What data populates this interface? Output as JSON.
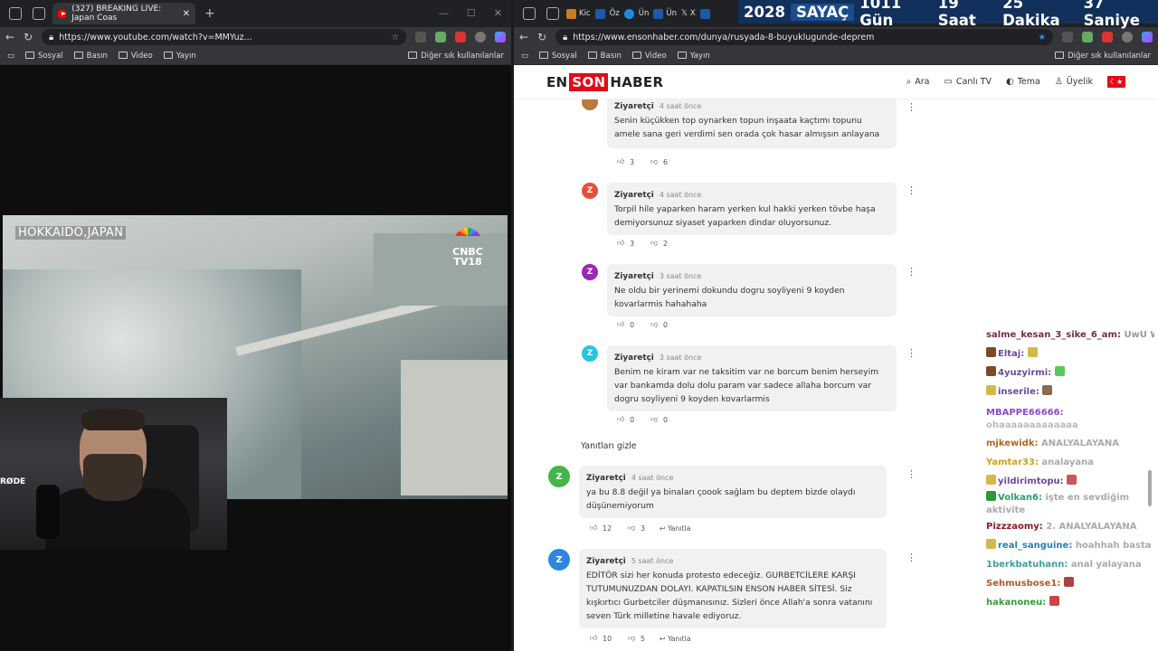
{
  "left": {
    "tab_title": "(327) BREAKING LIVE: Japan Coas",
    "url": "https://www.youtube.com/watch?v=MMYuz...",
    "bookmarks": [
      "Sosyal",
      "Basın",
      "Video",
      "Yayın"
    ],
    "bookmarks_right": "Diğer sık kullanılanlar",
    "video_location": "HOKKAIDO,JAPAN",
    "channel_logo_line1": "CNBC",
    "channel_logo_line2": "TV18",
    "cam_mic_brand": "RØDE"
  },
  "right": {
    "mini_tabs": [
      "Kic",
      "Öz",
      "Ün",
      "Ün",
      "X"
    ],
    "counter": {
      "label_year": "2028",
      "label_title": "SAYAÇ",
      "days": "1011 Gün",
      "hours": "19 Saat",
      "minutes": "25 Dakika",
      "seconds": "37 Saniye"
    },
    "url": "https://www.ensonhaber.com/dunya/rusyada-8-buyuklugunde-deprem",
    "bookmarks": [
      "Sosyal",
      "Basın",
      "Video",
      "Yayın"
    ],
    "bookmarks_right": "Diğer sık kullanılanlar",
    "logo": {
      "a": "EN",
      "b": "SON",
      "c": "HABER"
    },
    "nav": [
      "Ara",
      "Canlı TV",
      "Tema",
      "Üyelik"
    ],
    "flag_glyph": "☾★",
    "comments": [
      {
        "name": "Ziyaretçi",
        "time": "4 saat önce",
        "text": "Senin küçükken top oynarken topun inşaata kaçtımı topunu amele sana geri verdimi sen orada çok hasar almışsın anlayana",
        "likes": "3",
        "dislikes": "6",
        "avatar": "",
        "color": "#b97a3c"
      },
      {
        "name": "Ziyaretçi",
        "time": "4 saat önce",
        "text": "Torpil hile yaparken haram yerken kul hakki yerken tövbe haşa demiyorsunuz siyaset yaparken dindar oluyorsunuz.",
        "likes": "3",
        "dislikes": "2",
        "avatar": "Z",
        "color": "#e0533a"
      },
      {
        "name": "Ziyaretçi",
        "time": "3 saat önce",
        "text": "Ne oldu bir yerinemi dokundu dogru soyliyeni 9 koyden kovarlarmis hahahaha",
        "likes": "0",
        "dislikes": "0",
        "avatar": "Z",
        "color": "#9c27b0"
      },
      {
        "name": "Ziyaretçi",
        "time": "3 saat önce",
        "text": "Benim ne kiram var ne taksitim var ne borcum benim herseyim var bankamda dolu dolu param var sadece allaha borcum var dogru soyliyeni 9 koyden kovarlarmis",
        "likes": "0",
        "dislikes": "0",
        "avatar": "Z",
        "color": "#26c6da"
      },
      {
        "name": "Ziyaretçi",
        "time": "4 saat önce",
        "text": "ya bu 8.8 değil ya binaları çoook sağlam bu deptem bizde olaydı düşünemiyorum",
        "likes": "12",
        "dislikes": "3",
        "avatar": "Z",
        "color": "#43b549"
      },
      {
        "name": "Ziyaretçi",
        "time": "5 saat önce",
        "text": "EDİTÖR sizi her konuda protesto edeceğiz. GURBETCİLERE KARŞI TUTUMUNUZDAN DOLAYI. KAPATILSIN ENSON HABER SİTESİ. Siz kışkırtıcı Gurbetciler düşmanısınız. Sizleri önce Allah'a sonra vatanını seven Türk milletine havale ediyoruz.",
        "likes": "10",
        "dislikes": "5",
        "avatar": "Z",
        "color": "#2e86de"
      }
    ],
    "hide_replies": "Yanıtları gizle",
    "reply_label": "Yanıtla"
  },
  "chat": [
    {
      "user": "salme_kesan_3_sike_6_am:",
      "msg": "UwU W",
      "color": "#7a2a4a"
    },
    {
      "user": "Eltaj:",
      "msg": "",
      "color": "#6a4a9a"
    },
    {
      "user": "4yuzyirmi:",
      "msg": "",
      "color": "#6a4a9a"
    },
    {
      "user": "inserile:",
      "msg": "",
      "color": "#6a4a9a"
    },
    {
      "user": "MBAPPE66666:",
      "msg": "ohaaaaaaaaaaaaa",
      "color": "#8a4ad0"
    },
    {
      "user": "mjkewidk:",
      "msg": "ANALYALAYANA",
      "color": "#b5651d"
    },
    {
      "user": "Yamtar33:",
      "msg": "analayana",
      "color": "#c9a227"
    },
    {
      "user": "yildirimtopu:",
      "msg": "",
      "color": "#6a4a9a"
    },
    {
      "user": "Volkan6:",
      "msg": "işte en sevdiğim aktivite",
      "color": "#2e9b6a"
    },
    {
      "user": "Pizzzaomy:",
      "msg": "2. ANALYALAYANA",
      "color": "#8a1a2a"
    },
    {
      "user": "real_sanguine:",
      "msg": "hoahhah basta",
      "color": "#2a7fb5"
    },
    {
      "user": "1berkbatuhann:",
      "msg": "anal yalayana",
      "color": "#3aa0a0"
    },
    {
      "user": "Sehmusbose1:",
      "msg": "",
      "color": "#b55a1d"
    },
    {
      "user": "hakanoneu:",
      "msg": "",
      "color": "#3a9a3a"
    }
  ]
}
